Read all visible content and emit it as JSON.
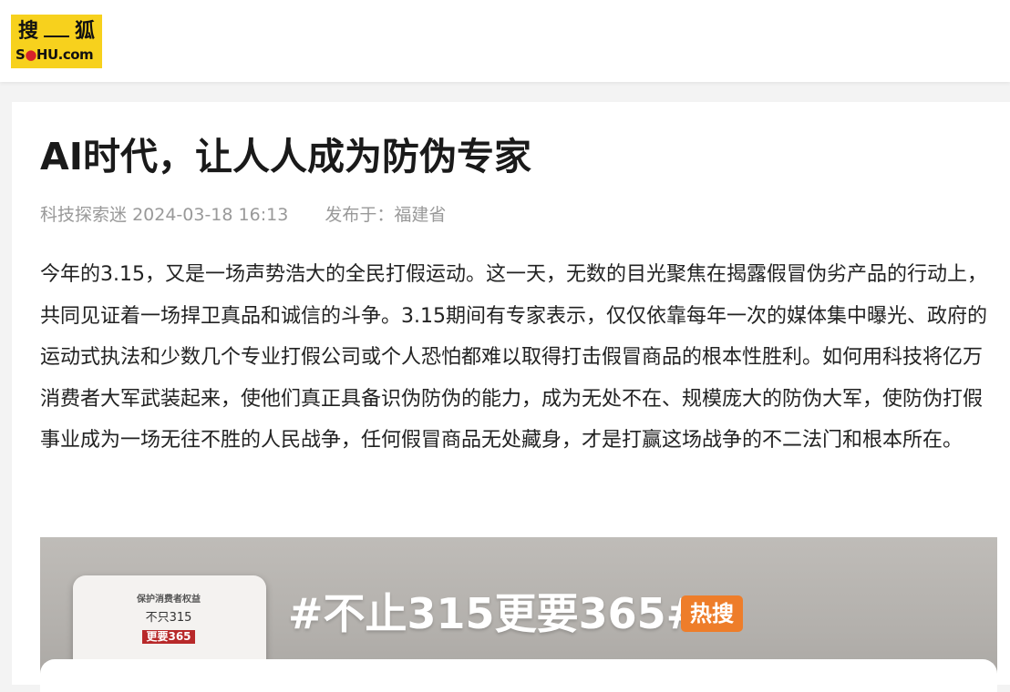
{
  "header": {
    "logo": {
      "cn_left": "搜",
      "cn_right": "狐",
      "en_pre": "S",
      "en_dot": "●",
      "en_post": "HU.com"
    }
  },
  "article": {
    "title": "AI时代，让人人成为防伪专家",
    "author": "科技探索迷",
    "datetime": "2024-03-18 16:13",
    "location_label": "发布于：",
    "location": "福建省",
    "paragraph": "今年的3.15，又是一场声势浩大的全民打假运动。这一天，无数的目光聚焦在揭露假冒伪劣产品的行动上，共同见证着一场捍卫真品和诚信的斗争。3.15期间有专家表示，仅仅依靠每年一次的媒体集中曝光、政府的运动式执法和少数几个专业打假公司或个人恐怕都难以取得打击假冒商品的根本性胜利。如何用科技将亿万消费者大军武装起来，使他们真正具备识伪防伪的能力，成为无处不在、规模庞大的防伪大军，使防伪打假事业成为一场无往不胜的人民战争，任何假冒商品无处藏身，才是打赢这场战争的不二法门和根本所在。"
  },
  "figure": {
    "product_line1": "保护消费者权益",
    "product_line2": "不只315",
    "product_line3": "更要365",
    "hashtag": "#不止315更要365#",
    "badge": "热搜"
  },
  "colors": {
    "logo_bg": "#f7d11d",
    "title": "#1a1a1a",
    "meta": "#999999",
    "body_text": "#222222",
    "badge": "#ee7d2a",
    "product_red": "#b8292a"
  }
}
